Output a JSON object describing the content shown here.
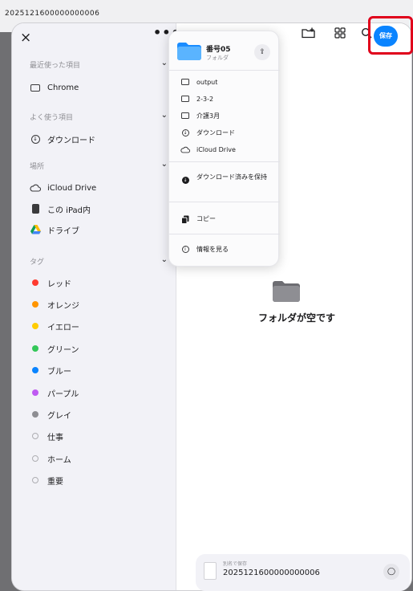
{
  "window": {
    "title": "2025121600000000006"
  },
  "sidebar": {
    "close_icon": "×",
    "more_icon": "•••",
    "sections": [
      {
        "title": "最近使った項目",
        "items": [
          {
            "label": "Chrome",
            "icon": "folder-outline"
          }
        ]
      },
      {
        "title": "よく使う項目",
        "items": [
          {
            "label": "ダウンロード",
            "icon": "download-circle"
          }
        ]
      },
      {
        "title": "場所",
        "items": [
          {
            "label": "iCloud Drive",
            "icon": "icloud"
          },
          {
            "label": "この iPad内",
            "icon": "ipad"
          },
          {
            "label": "ドライブ",
            "icon": "google-drive"
          }
        ]
      },
      {
        "title": "タグ",
        "items": [
          {
            "label": "レッド",
            "color": "#ff3b30"
          },
          {
            "label": "オレンジ",
            "color": "#ff9500"
          },
          {
            "label": "イエロー",
            "color": "#ffcc00"
          },
          {
            "label": "グリーン",
            "color": "#34c759"
          },
          {
            "label": "ブルー",
            "color": "#0a84ff"
          },
          {
            "label": "パープル",
            "color": "#bf5af2"
          },
          {
            "label": "グレイ",
            "color": "#8e8e93"
          },
          {
            "label": "仕事",
            "color": ""
          },
          {
            "label": "ホーム",
            "color": ""
          },
          {
            "label": "重要",
            "color": ""
          }
        ]
      }
    ]
  },
  "toolbar": {
    "new_folder_icon": "folder-badge-plus",
    "grid_icon": "grid",
    "search_icon": "magnifying-glass",
    "save_label": "保存"
  },
  "popup": {
    "folder_name": "番号05",
    "folder_kind": "フォルダ",
    "share_icon": "share",
    "locations": [
      {
        "label": "output",
        "icon": "folder"
      },
      {
        "label": "2-3-2",
        "icon": "folder"
      },
      {
        "label": "介護3月",
        "icon": "folder"
      },
      {
        "label": "ダウンロード",
        "icon": "download-circle"
      },
      {
        "label": "iCloud Drive",
        "icon": "icloud"
      }
    ],
    "keep_downloaded": "ダウンロード済みを保持",
    "copy": "コピー",
    "get_info": "情報を見る"
  },
  "main": {
    "empty_text": "フォルダが空です"
  },
  "bottom": {
    "save_as_label": "別名で保存",
    "filename": "2025121600000000006",
    "tag_icon": "tag"
  },
  "colors": {
    "accent": "#0a84ff",
    "highlight": "#e0001b"
  }
}
